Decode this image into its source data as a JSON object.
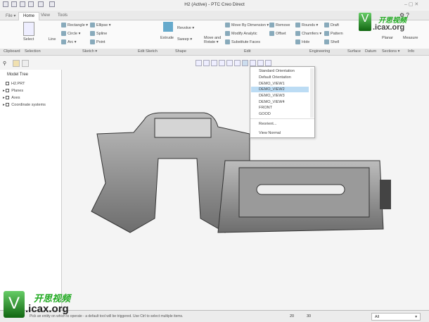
{
  "window": {
    "title": "H2 (Active) - PTC Creo Direct"
  },
  "tabs": [
    {
      "label": "File ▾"
    },
    {
      "label": "Home"
    },
    {
      "label": "View"
    },
    {
      "label": "Tools"
    }
  ],
  "ribbon": {
    "select": "Select",
    "line": "Line",
    "rectangle": "Rectangle ▾",
    "circle": "Circle ▾",
    "arc": "Arc ▾",
    "ellipse": "Ellipse ▾",
    "spline": "Spline",
    "point": "Point",
    "extrude": "Extrude",
    "revolve": "Revolve ▾",
    "sweep": "Sweep ▾",
    "move_rotate": "Move and Rotate ▾",
    "move_dim": "Move By Dimension ▾",
    "modify_analytic": "Modify Analytic",
    "substitute": "Substitute Faces",
    "remove": "Remove",
    "offset": "Offset",
    "rounds": "Rounds ▾",
    "chamfers": "Chamfers ▾",
    "hole": "Hole",
    "draft": "Draft",
    "pattern": "Pattern",
    "shell": "Shell",
    "planar": "Planar",
    "measure": "Measure"
  },
  "groups": [
    "Clipboard",
    "Selection",
    "Sketch ▾",
    "Edit Sketch",
    "Shape",
    "Edit",
    "Engineering",
    "Surface",
    "Datum",
    "Sections ▾",
    "Info"
  ],
  "model_tree": {
    "title": "Model Tree",
    "items": [
      "H2.PRT",
      "Planes",
      "Axes",
      "Coordinate systems"
    ]
  },
  "orientation_menu": {
    "items": [
      "Standard Orientation",
      "Default Orientation",
      "DEMO_VIEW1",
      "DEMO_VIEW2",
      "DEMO_VIEW3",
      "DEMO_VIEW4",
      "FRONT",
      "GOOD"
    ],
    "selected": "DEMO_VIEW2",
    "actions": [
      "Reorient...",
      "View Normal"
    ]
  },
  "status": {
    "message": "Pick an entity on which to operate - a default tool will be triggered. Use Ctrl to select multiple items.",
    "count_2d": "20",
    "count_3d": "30",
    "filter": "All"
  },
  "watermark": {
    "cn": "开思视频",
    "url": ".icax.org",
    "letter": "V"
  }
}
